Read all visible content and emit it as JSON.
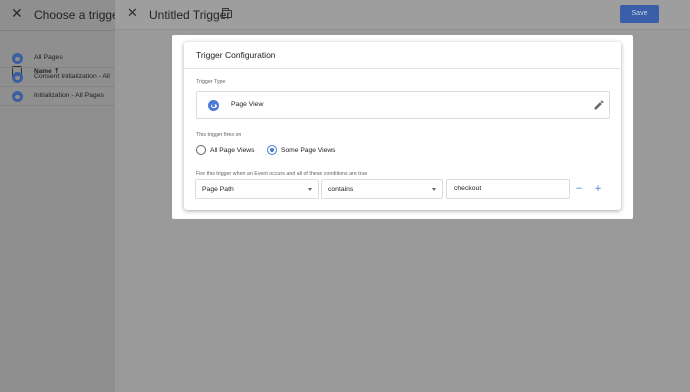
{
  "trigger_list": {
    "title": "Choose a trigger",
    "column_name": "Name",
    "sort_arrow": "↑",
    "items": [
      {
        "label": "All Pages"
      },
      {
        "label": "Consent Initialization - All"
      },
      {
        "label": "Initialization - All Pages"
      }
    ]
  },
  "editor": {
    "title": "Untitled Trigger",
    "save_label": "Save"
  },
  "config": {
    "title": "Trigger Configuration",
    "type_label": "Trigger Type",
    "type_value": "Page View",
    "fires_on_label": "This trigger fires on",
    "radio_options": [
      {
        "label": "All Page Views",
        "selected": false
      },
      {
        "label": "Some Page Views",
        "selected": true
      }
    ],
    "condition_label": "Fire this trigger when an Event occurs and all of these conditions are true",
    "condition": {
      "variable": "Page Path",
      "operator": "contains",
      "value": "checkout",
      "remove_label": "−",
      "add_label": "+"
    }
  },
  "colors": {
    "accent": "#4a7bd6",
    "save_button": "#3a5fa8"
  }
}
